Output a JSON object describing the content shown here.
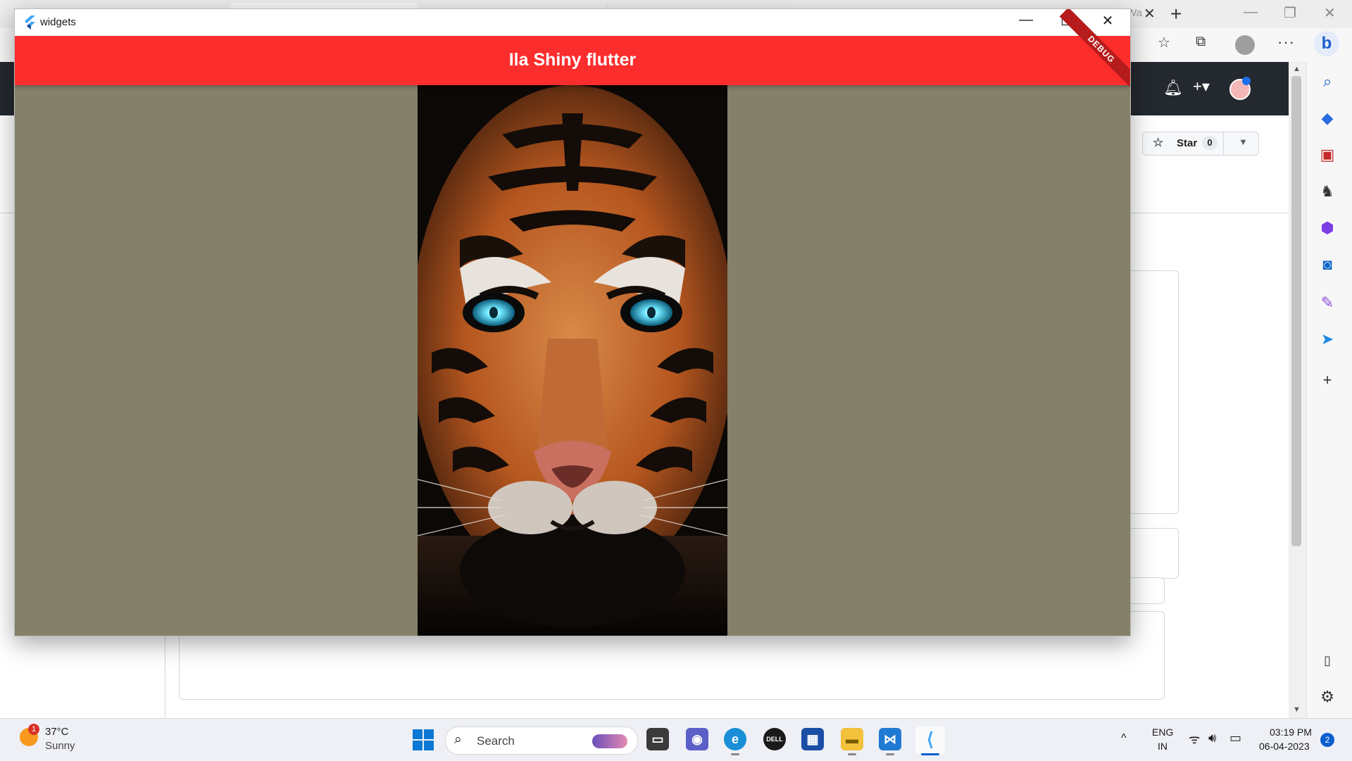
{
  "browser": {
    "tab_fragment": "Wa",
    "tab_close": "✕",
    "new_tab": "+",
    "more": "···",
    "bing": "b",
    "window_controls": [
      "—",
      "❐",
      "✕"
    ]
  },
  "github": {
    "star_label": "Star",
    "star_count": "0"
  },
  "flutter_window": {
    "title": "widgets",
    "minimize": "—",
    "maximize": "☐",
    "close": "✕",
    "appbar_title": "Ila Shiny flutter",
    "debug_banner": "DEBUG",
    "background_color": "#858069",
    "appbar_color": "#fc2d2d"
  },
  "taskbar": {
    "weather_temp": "37°C",
    "weather_condition": "Sunny",
    "weather_alert_count": "1",
    "search_placeholder": "Search",
    "language_top": "ENG",
    "language_bottom": "IN",
    "time": "03:19 PM",
    "date": "06-04-2023",
    "notification_count": "2",
    "tray_chevron": "^"
  },
  "sidebar_icons": [
    "search-icon",
    "tag-icon",
    "toolbox-icon",
    "chess-icon",
    "office-icon",
    "outlook-icon",
    "designer-icon",
    "send-icon",
    "add-icon"
  ]
}
